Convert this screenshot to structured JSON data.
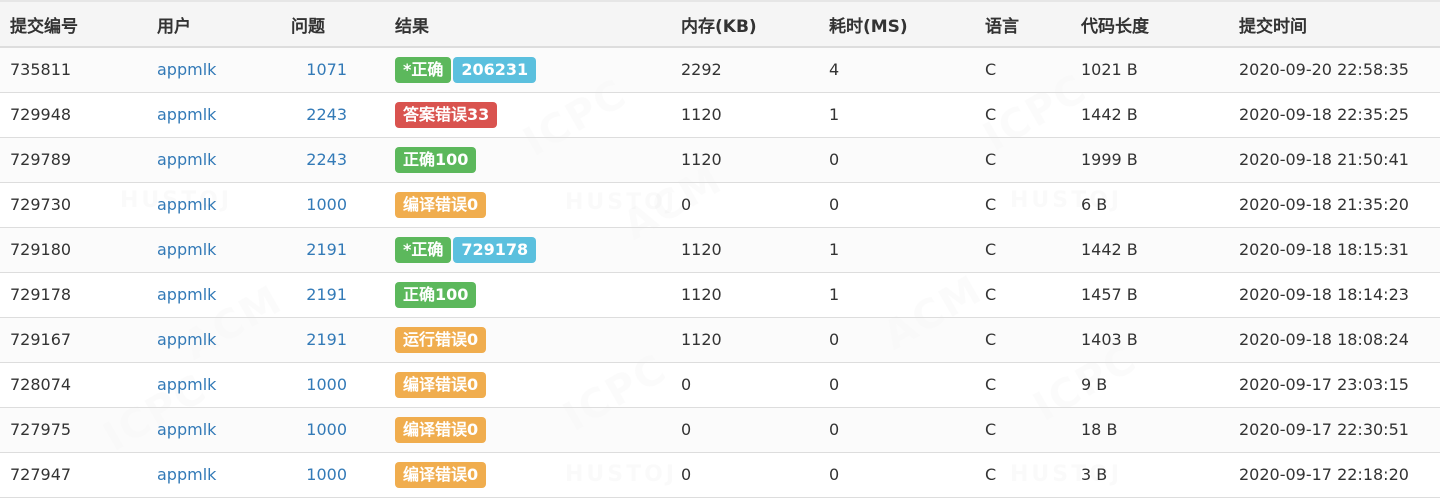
{
  "table": {
    "headers": [
      "提交编号",
      "用户",
      "问题",
      "结果",
      "内存(KB)",
      "耗时(MS)",
      "语言",
      "代码长度",
      "提交时间"
    ],
    "rows": [
      {
        "id": "735811",
        "user": "appmlk",
        "problem": "1071",
        "results": [
          {
            "text": "*正确",
            "color": "success"
          },
          {
            "text": "206231",
            "color": "info"
          }
        ],
        "memory": "2292",
        "time": "4",
        "lang": "C",
        "length": "1021 B",
        "submitted": "2020-09-20 22:58:35"
      },
      {
        "id": "729948",
        "user": "appmlk",
        "problem": "2243",
        "results": [
          {
            "text": "答案错误33",
            "color": "danger"
          }
        ],
        "memory": "1120",
        "time": "1",
        "lang": "C",
        "length": "1442 B",
        "submitted": "2020-09-18 22:35:25"
      },
      {
        "id": "729789",
        "user": "appmlk",
        "problem": "2243",
        "results": [
          {
            "text": "正确100",
            "color": "success"
          }
        ],
        "memory": "1120",
        "time": "0",
        "lang": "C",
        "length": "1999 B",
        "submitted": "2020-09-18 21:50:41"
      },
      {
        "id": "729730",
        "user": "appmlk",
        "problem": "1000",
        "results": [
          {
            "text": "编译错误0",
            "color": "warning"
          }
        ],
        "memory": "0",
        "time": "0",
        "lang": "C",
        "length": "6 B",
        "submitted": "2020-09-18 21:35:20"
      },
      {
        "id": "729180",
        "user": "appmlk",
        "problem": "2191",
        "results": [
          {
            "text": "*正确",
            "color": "success"
          },
          {
            "text": "729178",
            "color": "info"
          }
        ],
        "memory": "1120",
        "time": "1",
        "lang": "C",
        "length": "1442 B",
        "submitted": "2020-09-18 18:15:31"
      },
      {
        "id": "729178",
        "user": "appmlk",
        "problem": "2191",
        "results": [
          {
            "text": "正确100",
            "color": "success"
          }
        ],
        "memory": "1120",
        "time": "1",
        "lang": "C",
        "length": "1457 B",
        "submitted": "2020-09-18 18:14:23"
      },
      {
        "id": "729167",
        "user": "appmlk",
        "problem": "2191",
        "results": [
          {
            "text": "运行错误0",
            "color": "warning"
          }
        ],
        "memory": "1120",
        "time": "0",
        "lang": "C",
        "length": "1403 B",
        "submitted": "2020-09-18 18:08:24"
      },
      {
        "id": "728074",
        "user": "appmlk",
        "problem": "1000",
        "results": [
          {
            "text": "编译错误0",
            "color": "warning"
          }
        ],
        "memory": "0",
        "time": "0",
        "lang": "C",
        "length": "9 B",
        "submitted": "2020-09-17 23:03:15"
      },
      {
        "id": "727975",
        "user": "appmlk",
        "problem": "1000",
        "results": [
          {
            "text": "编译错误0",
            "color": "warning"
          }
        ],
        "memory": "0",
        "time": "0",
        "lang": "C",
        "length": "18 B",
        "submitted": "2020-09-17 22:30:51"
      },
      {
        "id": "727947",
        "user": "appmlk",
        "problem": "1000",
        "results": [
          {
            "text": "编译错误0",
            "color": "warning"
          }
        ],
        "memory": "0",
        "time": "0",
        "lang": "C",
        "length": "3 B",
        "submitted": "2020-09-17 22:18:20"
      }
    ]
  },
  "watermark": {
    "texts": [
      "HUSTOJ",
      "ACM",
      "ICPC"
    ]
  },
  "colors": {
    "success": "#5cb85c",
    "danger": "#d9534f",
    "warning": "#f0ad4e",
    "info": "#5bc0de",
    "link": "#337ab7"
  }
}
